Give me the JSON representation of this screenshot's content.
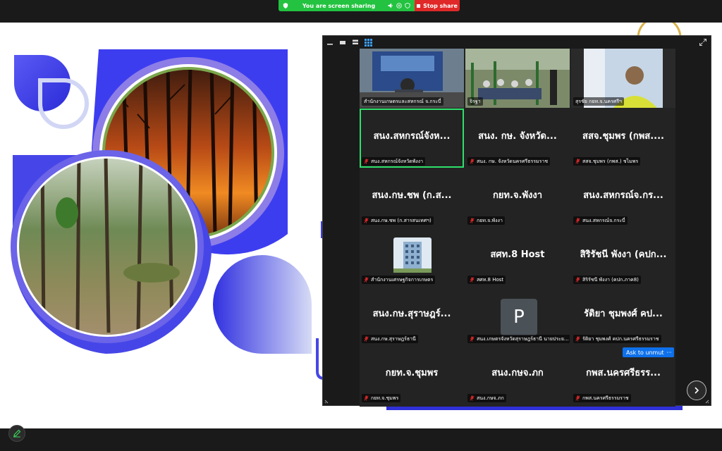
{
  "share_bar": {
    "status_text": "You are screen sharing",
    "stop_label": "Stop share",
    "status_color": "#23c240",
    "stop_color": "#e02828"
  },
  "gallery": {
    "ask_unmute_label": "Ask to unmute",
    "more_label": "···",
    "avatar_initial": "P",
    "active_border_color": "#2ee06a",
    "tiles": [
      {
        "big": "",
        "label": "สำนักงานเกษตรและสหกรณ์ จ.กระบี่"
      },
      {
        "big": "",
        "label": "จิรฐา"
      },
      {
        "big": "",
        "label": "สุรชัย กยท.จ.นครศรีฯ"
      },
      {
        "big": "สนง.สหกรณ์จังห...",
        "label": "สนง.สหกรณ์จังหวัดพังงา"
      },
      {
        "big": "สนง. กษ. จังหวัด...",
        "label": "สนง. กษ. จังหวัดนครศรีธรรมราช"
      },
      {
        "big": "สสจ.ชุมพร (กพส....",
        "label": "สสจ.ชุมพร (กพส.) ชไมพร"
      },
      {
        "big": "สนง.กษ.ชพ (ก.ส...",
        "label": "สนง.กษ.ชพ (ก.สารสนเทศฯ)"
      },
      {
        "big": "กยท.จ.พังงา",
        "label": "กยท.จ.พังงา"
      },
      {
        "big": "สนง.สหกรณ์จ.กร...",
        "label": "สนง.สหกรณ์จ.กระบี่"
      },
      {
        "big": "",
        "label": "สำนักงานเศรษฐกิจการเกษตร"
      },
      {
        "big": "สศท.8 Host",
        "label": "สศท.8 Host"
      },
      {
        "big": "สิริรัชนี พังงา (คปก...",
        "label": "สิริรัชนี พังงา (คปก.ภาค8)"
      },
      {
        "big": "สนง.กษ.สุราษฎร์...",
        "label": "สนง.กษ.สุราษฎร์ธานี"
      },
      {
        "big": "",
        "label": "สนง.เกษตรจังหวัดสุราษฎร์ธานี นายประย..."
      },
      {
        "big": "รัติยา ชุมพงศ์ คป...",
        "label": "รัติยา ชุมพงศ์ คปก.นครศรีธรรมราช"
      },
      {
        "big": "กยท.จ.ชุมพร",
        "label": "กยท.จ.ชุมพร"
      },
      {
        "big": "สนง.กษจ.ภก",
        "label": "สนง.กษจ.ภก"
      },
      {
        "big": "กพส.นครศรีธรร...",
        "label": "กพส.นครศรีธรรมราช"
      }
    ]
  },
  "slide": {
    "accent_blue": "#3d3df0",
    "accent_purple": "#8d7de6"
  }
}
